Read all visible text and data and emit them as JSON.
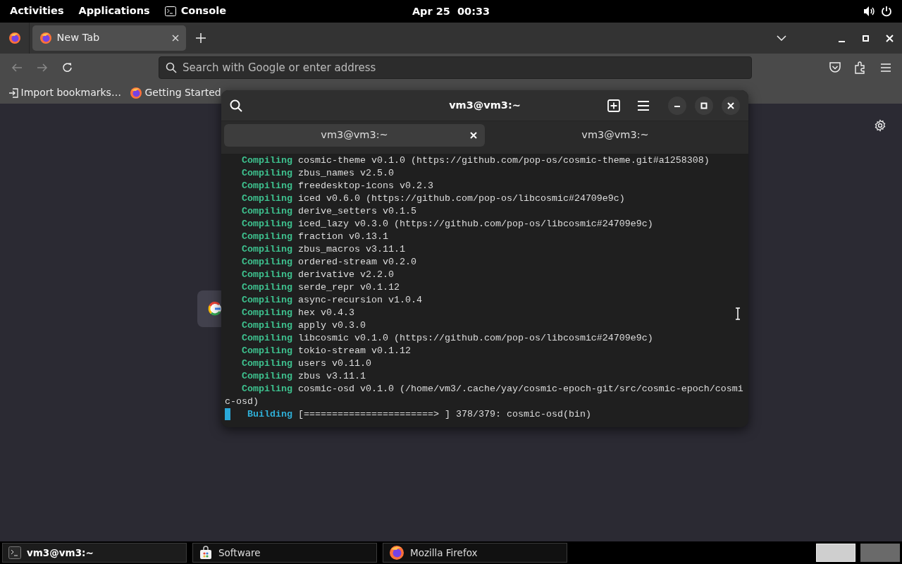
{
  "top_bar": {
    "activities": "Activities",
    "applications": "Applications",
    "console": "Console",
    "clock": "Apr 25  00:33"
  },
  "browser": {
    "tabs": [
      {
        "title": "New Tab",
        "selected": true
      }
    ],
    "address_bar": {
      "placeholder": "Search with Google or enter address"
    },
    "bookmarks": [
      {
        "label": "Import bookmarks…",
        "kind": "import"
      },
      {
        "label": "Getting Started",
        "kind": "firefox"
      }
    ]
  },
  "terminal": {
    "title": "vm3@vm3:~",
    "tabs": [
      {
        "label": "vm3@vm3:~",
        "selected": true
      },
      {
        "label": "vm3@vm3:~",
        "selected": false
      }
    ],
    "lines": [
      {
        "kind": "compiling",
        "status": "Compiling",
        "text": "cosmic-theme v0.1.0 (https://github.com/pop-os/cosmic-theme.git#a1258308)"
      },
      {
        "kind": "compiling",
        "status": "Compiling",
        "text": "zbus_names v2.5.0"
      },
      {
        "kind": "compiling",
        "status": "Compiling",
        "text": "freedesktop-icons v0.2.3"
      },
      {
        "kind": "compiling",
        "status": "Compiling",
        "text": "iced v0.6.0 (https://github.com/pop-os/libcosmic#24709e9c)"
      },
      {
        "kind": "compiling",
        "status": "Compiling",
        "text": "derive_setters v0.1.5"
      },
      {
        "kind": "compiling",
        "status": "Compiling",
        "text": "iced_lazy v0.3.0 (https://github.com/pop-os/libcosmic#24709e9c)"
      },
      {
        "kind": "compiling",
        "status": "Compiling",
        "text": "fraction v0.13.1"
      },
      {
        "kind": "compiling",
        "status": "Compiling",
        "text": "zbus_macros v3.11.1"
      },
      {
        "kind": "compiling",
        "status": "Compiling",
        "text": "ordered-stream v0.2.0"
      },
      {
        "kind": "compiling",
        "status": "Compiling",
        "text": "derivative v2.2.0"
      },
      {
        "kind": "compiling",
        "status": "Compiling",
        "text": "serde_repr v0.1.12"
      },
      {
        "kind": "compiling",
        "status": "Compiling",
        "text": "async-recursion v1.0.4"
      },
      {
        "kind": "compiling",
        "status": "Compiling",
        "text": "hex v0.4.3"
      },
      {
        "kind": "compiling",
        "status": "Compiling",
        "text": "apply v0.3.0"
      },
      {
        "kind": "compiling",
        "status": "Compiling",
        "text": "libcosmic v0.1.0 (https://github.com/pop-os/libcosmic#24709e9c)"
      },
      {
        "kind": "compiling",
        "status": "Compiling",
        "text": "tokio-stream v0.1.12"
      },
      {
        "kind": "compiling",
        "status": "Compiling",
        "text": "users v0.11.0"
      },
      {
        "kind": "compiling",
        "status": "Compiling",
        "text": "zbus v3.11.1"
      },
      {
        "kind": "compiling",
        "status": "Compiling",
        "text": "cosmic-osd v0.1.0 (/home/vm3/.cache/yay/cosmic-epoch-git/src/cosmic-epoch/cosmi"
      },
      {
        "kind": "continuation",
        "text": "c-osd)"
      },
      {
        "kind": "building",
        "status": "Building",
        "text": "[=======================> ] 378/379: cosmic-osd(bin)"
      }
    ]
  },
  "taskbar": {
    "items": [
      {
        "label": "vm3@vm3:~",
        "kind": "terminal",
        "selected": true
      },
      {
        "label": "Software",
        "kind": "software",
        "selected": false
      },
      {
        "label": "Mozilla Firefox",
        "kind": "firefox",
        "selected": false
      }
    ],
    "workspaces": [
      {
        "selected": true
      },
      {
        "selected": false
      }
    ]
  }
}
